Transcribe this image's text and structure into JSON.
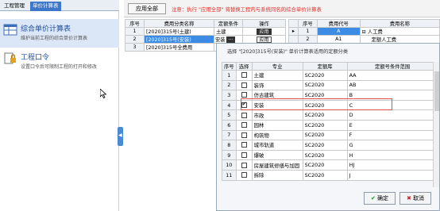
{
  "left_panel": {
    "tabs": [
      "工程管理",
      "单价计算表"
    ],
    "modules": [
      {
        "title": "综合单价计算表",
        "desc": "维护当前工程的综合单价计算表"
      },
      {
        "title": "工程口令",
        "desc": "设置口令后可限制工程的打开和修改"
      }
    ]
  },
  "toolbar": {
    "apply_all": "应用全部",
    "notice": "注意：执行 \"应用全部\" 将替换工程内与系统同名的综合单价计算表"
  },
  "left_grid": {
    "headers": [
      "序号",
      "费用分类名称",
      "定额条件",
      "操作"
    ],
    "rows": [
      {
        "no": "1",
        "name": "[2020]315号(土建)",
        "cond": "土建",
        "op": "应用"
      },
      {
        "no": "2",
        "name": "[2020]315号(安装)",
        "cond": "安装",
        "op": "应用"
      },
      {
        "no": "3",
        "name": "[2020]315号全费用",
        "cond": "",
        "op": ""
      }
    ]
  },
  "right_grid": {
    "headers": [
      "序号",
      "费用代号",
      "费用名称"
    ],
    "rows": [
      {
        "no": "1",
        "code": "A",
        "name": "人工费"
      },
      {
        "no": "2",
        "code": "A1",
        "name": "定额人工费"
      }
    ]
  },
  "dialog": {
    "title": "选择 \"[2020]315号(安装)\" 单价计算表适用的定额分类",
    "headers": [
      "序号",
      "选择",
      "专业",
      "定额库",
      "定额号条件范围"
    ],
    "rows": [
      {
        "no": "1",
        "checked": false,
        "major": "土建",
        "lib": "SC2020",
        "range": "AA"
      },
      {
        "no": "2",
        "checked": false,
        "major": "装饰",
        "lib": "SC2020",
        "range": "AB"
      },
      {
        "no": "3",
        "checked": false,
        "major": "仿古建筑",
        "lib": "SC2020",
        "range": "B"
      },
      {
        "no": "4",
        "checked": true,
        "major": "安装",
        "lib": "SC2020",
        "range": "C"
      },
      {
        "no": "5",
        "checked": false,
        "major": "市政",
        "lib": "SC2020",
        "range": "D"
      },
      {
        "no": "6",
        "checked": false,
        "major": "园林",
        "lib": "SC2020",
        "range": "E"
      },
      {
        "no": "7",
        "checked": false,
        "major": "构筑物",
        "lib": "SC2020",
        "range": "F"
      },
      {
        "no": "8",
        "checked": false,
        "major": "城市轨道",
        "lib": "SC2020",
        "range": "G"
      },
      {
        "no": "9",
        "checked": false,
        "major": "爆破",
        "lib": "SC2020",
        "range": "H"
      },
      {
        "no": "10",
        "checked": false,
        "major": "房屋建筑修缮与加固",
        "lib": "SC2020",
        "range": "HJ"
      },
      {
        "no": "11",
        "checked": false,
        "major": "拆除",
        "lib": "SC2020",
        "range": "J"
      }
    ],
    "ok_label": "确定",
    "cancel_label": "取消"
  },
  "colors": {
    "accent": "#3c8ce6",
    "notice": "#e0302a",
    "highlight": "#e05050"
  }
}
